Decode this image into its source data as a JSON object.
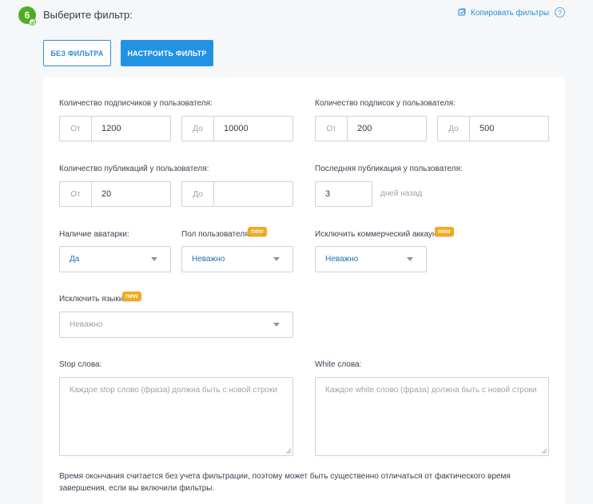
{
  "step": {
    "number": "6",
    "title": "Выберите фильтр:"
  },
  "header": {
    "copy_label": "Копировать фильтры",
    "help_label": "?"
  },
  "modes": {
    "no_filter": "БЕЗ ФИЛЬТРА",
    "custom": "НАСТРОИТЬ ФИЛЬТР"
  },
  "filters": {
    "followers": {
      "label": "Количество подписчиков у пользователя:",
      "from_prefix": "От",
      "from_value": "1200",
      "to_prefix": "До",
      "to_value": "10000"
    },
    "following": {
      "label": "Количество подписок у пользователя:",
      "from_prefix": "От",
      "from_value": "200",
      "to_prefix": "До",
      "to_value": "500"
    },
    "posts": {
      "label": "Количество публикаций у пользователя:",
      "from_prefix": "От",
      "from_value": "20",
      "to_prefix": "До",
      "to_value": ""
    },
    "last_post": {
      "label": "Последняя публикация у пользователя:",
      "value": "3",
      "suffix": "дней назад"
    },
    "avatar": {
      "label": "Наличие аватарки:",
      "selected": "Да"
    },
    "gender": {
      "label": "Пол пользователя:",
      "badge": "new",
      "selected": "Неважно"
    },
    "commercial": {
      "label": "Исключить коммерческий аккаунт:",
      "badge": "new",
      "selected": "Неважно"
    },
    "languages": {
      "label": "Исключить языки:",
      "badge": "new",
      "placeholder": "Неважно"
    },
    "stop_words": {
      "label": "Stop слова:",
      "placeholder": "Каждое stop слово (фраза) должна быть с новой строки"
    },
    "white_words": {
      "label": "White слова:",
      "placeholder": "Каждое white слово (фраза) должна быть с новой строки"
    }
  },
  "note": "Время окончания считается без учета фильтрации, поэтому может быть существенно отличаться от фактического время завершения, если вы включили фильтры.",
  "colors": {
    "accent": "#2293e3",
    "success": "#4caf22",
    "badge": "#f4a81c"
  }
}
